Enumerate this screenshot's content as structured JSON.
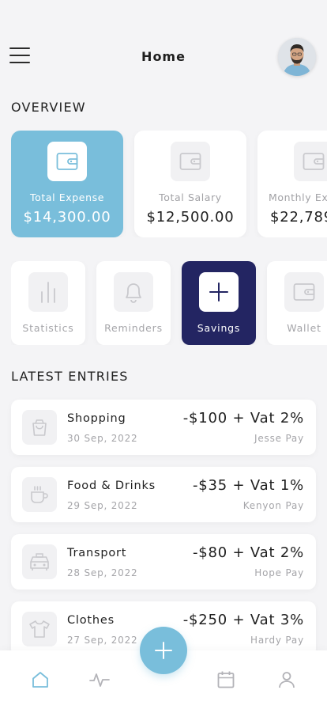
{
  "header": {
    "title": "Home",
    "menu_icon": "menu-icon",
    "avatar_icon": "user-avatar"
  },
  "overview": {
    "title": "OVERVIEW",
    "cards": [
      {
        "label": "Total Expense",
        "amount": "$14,300.00",
        "icon": "wallet-icon",
        "active": true
      },
      {
        "label": "Total Salary",
        "amount": "$12,500.00",
        "icon": "wallet-icon",
        "active": false
      },
      {
        "label": "Monthly Ex",
        "amount": "$22,789",
        "icon": "wallet-icon",
        "active": false
      }
    ]
  },
  "quick_actions": [
    {
      "label": "Statistics",
      "icon": "bar-chart-icon",
      "active": false
    },
    {
      "label": "Reminders",
      "icon": "bell-icon",
      "active": false
    },
    {
      "label": "Savings",
      "icon": "plus-icon",
      "active": true
    },
    {
      "label": "Wallet",
      "icon": "wallet-icon",
      "active": false
    }
  ],
  "latest": {
    "title": "LATEST ENTRIES",
    "entries": [
      {
        "name": "Shopping",
        "date": "30 Sep, 2022",
        "amount": "-$100 + Vat 2%",
        "payee": "Jesse Pay",
        "icon": "shopping-bag-icon"
      },
      {
        "name": "Food & Drinks",
        "date": "29 Sep, 2022",
        "amount": "-$35 + Vat 1%",
        "payee": "Kenyon Pay",
        "icon": "coffee-cup-icon"
      },
      {
        "name": "Transport",
        "date": "28 Sep, 2022",
        "amount": "-$80 + Vat 2%",
        "payee": "Hope Pay",
        "icon": "taxi-icon"
      },
      {
        "name": "Clothes",
        "date": "27 Sep, 2022",
        "amount": "-$250 + Vat 3%",
        "payee": "Hardy Pay",
        "icon": "shirt-icon"
      }
    ]
  },
  "bottom_nav": {
    "items": [
      "home-icon",
      "activity-icon",
      "calendar-icon",
      "profile-icon"
    ],
    "active": "home-icon",
    "fab_icon": "plus-icon"
  },
  "colors": {
    "accent": "#79bedb",
    "savings": "#232562",
    "background": "#f4f4f6",
    "muted_text": "#a5a5a9"
  }
}
